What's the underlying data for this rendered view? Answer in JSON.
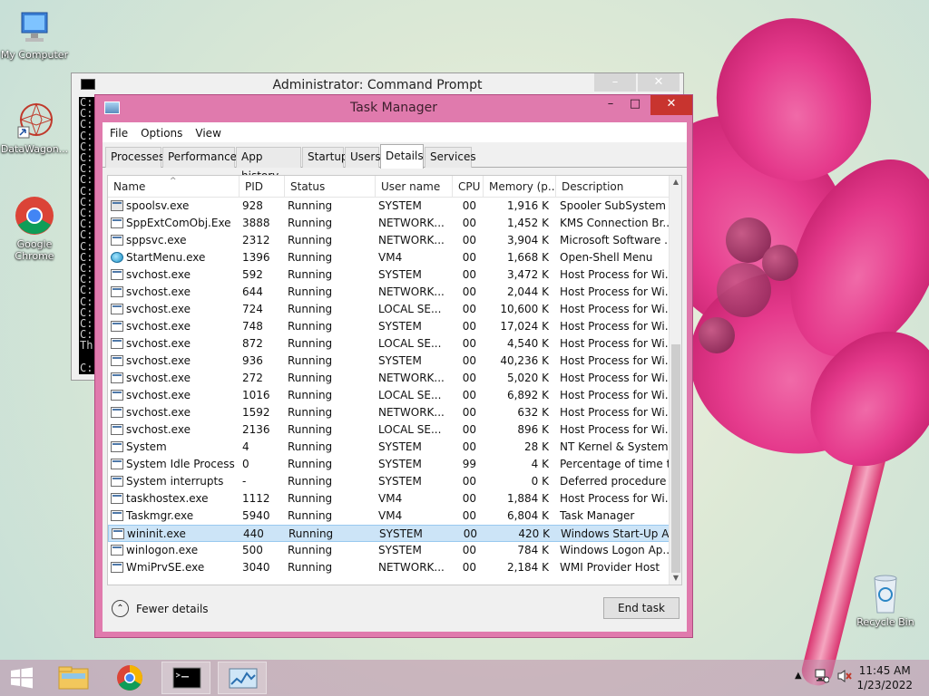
{
  "desktop": {
    "icons": [
      {
        "label": "My Computer"
      },
      {
        "label": "DataWagon..."
      },
      {
        "label": "Google Chrome"
      },
      {
        "label": "Recycle Bin"
      }
    ]
  },
  "cmd_window": {
    "title": "Administrator: Command Prompt",
    "console_lines": "C:\nC:\nC:\nC:\nC:\nC:\nC:\nC:\nC:\nC:\nC:\nC:\nC:\nC:\nC:\nC:\nC:\nC:\nC:\nC:\nC:\nC:\nTh\n\nC:"
  },
  "task_manager": {
    "title": "Task Manager",
    "menu": [
      "File",
      "Options",
      "View"
    ],
    "tabs": [
      "Processes",
      "Performance",
      "App history",
      "Startup",
      "Users",
      "Details",
      "Services"
    ],
    "active_tab": "Details",
    "columns": [
      "Name",
      "PID",
      "Status",
      "User name",
      "CPU",
      "Memory (p...",
      "Description"
    ],
    "sort_glyph": "^",
    "rows": [
      {
        "name": "spoolsv.exe",
        "pid": "928",
        "status": "Running",
        "user": "SYSTEM",
        "cpu": "00",
        "mem": "1,916 K",
        "desc": "Spooler SubSystem ...",
        "icon": "printer"
      },
      {
        "name": "SppExtComObj.Exe",
        "pid": "3888",
        "status": "Running",
        "user": "NETWORK...",
        "cpu": "00",
        "mem": "1,452 K",
        "desc": "KMS Connection Br...",
        "icon": "window"
      },
      {
        "name": "sppsvc.exe",
        "pid": "2312",
        "status": "Running",
        "user": "NETWORK...",
        "cpu": "00",
        "mem": "3,904 K",
        "desc": "Microsoft Software ...",
        "icon": "window"
      },
      {
        "name": "StartMenu.exe",
        "pid": "1396",
        "status": "Running",
        "user": "VM4",
        "cpu": "00",
        "mem": "1,668 K",
        "desc": "Open-Shell Menu",
        "icon": "globe"
      },
      {
        "name": "svchost.exe",
        "pid": "592",
        "status": "Running",
        "user": "SYSTEM",
        "cpu": "00",
        "mem": "3,472 K",
        "desc": "Host Process for Wi...",
        "icon": "window"
      },
      {
        "name": "svchost.exe",
        "pid": "644",
        "status": "Running",
        "user": "NETWORK...",
        "cpu": "00",
        "mem": "2,044 K",
        "desc": "Host Process for Wi...",
        "icon": "window"
      },
      {
        "name": "svchost.exe",
        "pid": "724",
        "status": "Running",
        "user": "LOCAL SE...",
        "cpu": "00",
        "mem": "10,600 K",
        "desc": "Host Process for Wi...",
        "icon": "window"
      },
      {
        "name": "svchost.exe",
        "pid": "748",
        "status": "Running",
        "user": "SYSTEM",
        "cpu": "00",
        "mem": "17,024 K",
        "desc": "Host Process for Wi...",
        "icon": "window"
      },
      {
        "name": "svchost.exe",
        "pid": "872",
        "status": "Running",
        "user": "LOCAL SE...",
        "cpu": "00",
        "mem": "4,540 K",
        "desc": "Host Process for Wi...",
        "icon": "window"
      },
      {
        "name": "svchost.exe",
        "pid": "936",
        "status": "Running",
        "user": "SYSTEM",
        "cpu": "00",
        "mem": "40,236 K",
        "desc": "Host Process for Wi...",
        "icon": "window"
      },
      {
        "name": "svchost.exe",
        "pid": "272",
        "status": "Running",
        "user": "NETWORK...",
        "cpu": "00",
        "mem": "5,020 K",
        "desc": "Host Process for Wi...",
        "icon": "window"
      },
      {
        "name": "svchost.exe",
        "pid": "1016",
        "status": "Running",
        "user": "LOCAL SE...",
        "cpu": "00",
        "mem": "6,892 K",
        "desc": "Host Process for Wi...",
        "icon": "window"
      },
      {
        "name": "svchost.exe",
        "pid": "1592",
        "status": "Running",
        "user": "NETWORK...",
        "cpu": "00",
        "mem": "632 K",
        "desc": "Host Process for Wi...",
        "icon": "window"
      },
      {
        "name": "svchost.exe",
        "pid": "2136",
        "status": "Running",
        "user": "LOCAL SE...",
        "cpu": "00",
        "mem": "896 K",
        "desc": "Host Process for Wi...",
        "icon": "window"
      },
      {
        "name": "System",
        "pid": "4",
        "status": "Running",
        "user": "SYSTEM",
        "cpu": "00",
        "mem": "28 K",
        "desc": "NT Kernel & System",
        "icon": "window"
      },
      {
        "name": "System Idle Process",
        "pid": "0",
        "status": "Running",
        "user": "SYSTEM",
        "cpu": "99",
        "mem": "4 K",
        "desc": "Percentage of time t...",
        "icon": "window"
      },
      {
        "name": "System interrupts",
        "pid": "-",
        "status": "Running",
        "user": "SYSTEM",
        "cpu": "00",
        "mem": "0 K",
        "desc": "Deferred procedure ...",
        "icon": "window"
      },
      {
        "name": "taskhostex.exe",
        "pid": "1112",
        "status": "Running",
        "user": "VM4",
        "cpu": "00",
        "mem": "1,884 K",
        "desc": "Host Process for Wi...",
        "icon": "window"
      },
      {
        "name": "Taskmgr.exe",
        "pid": "5940",
        "status": "Running",
        "user": "VM4",
        "cpu": "00",
        "mem": "6,804 K",
        "desc": "Task Manager",
        "icon": "window"
      },
      {
        "name": "wininit.exe",
        "pid": "440",
        "status": "Running",
        "user": "SYSTEM",
        "cpu": "00",
        "mem": "420 K",
        "desc": "Windows Start-Up A...",
        "icon": "window",
        "selected": true
      },
      {
        "name": "winlogon.exe",
        "pid": "500",
        "status": "Running",
        "user": "SYSTEM",
        "cpu": "00",
        "mem": "784 K",
        "desc": "Windows Logon Ap...",
        "icon": "window"
      },
      {
        "name": "WmiPrvSE.exe",
        "pid": "3040",
        "status": "Running",
        "user": "NETWORK...",
        "cpu": "00",
        "mem": "2,184 K",
        "desc": "WMI Provider Host",
        "icon": "window"
      }
    ],
    "fewer_details": "Fewer details",
    "end_task": "End task"
  },
  "taskbar": {
    "clock_time": "11:45 AM",
    "clock_date": "1/23/2022"
  },
  "colors": {
    "accent": "#e07aad",
    "close": "#c8342f",
    "selection": "#cce4f7"
  }
}
